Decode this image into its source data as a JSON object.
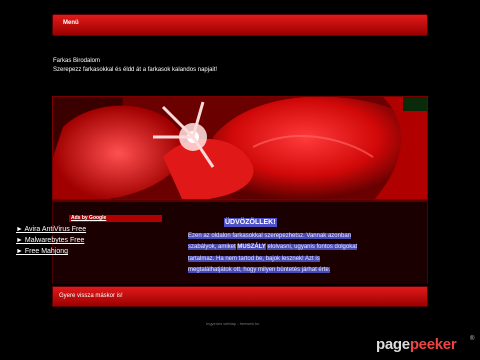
{
  "nav": {
    "menu_label": "Menü"
  },
  "site": {
    "title": "Farkas Birodalom",
    "subtitle": "Szerepezz farkasokkal és éldd át a farkasok kalandos napjait!"
  },
  "ads": {
    "header": "Ads by Google",
    "links": [
      "► Avira AntiVirus Free",
      "► Malwarebytes Free",
      "► Free Mahjong"
    ]
  },
  "welcome": {
    "title": "ÜDVÖZÖLLEK!",
    "lines": [
      "Ezen az oldalon farkasokkal szerepezhetsz. Vannak azonban",
      "szabályok, amiket",
      "MUSZÁLY",
      "elolvasni, ugyanis fontos dolgokat",
      "tartalmaz. Ha nem tartod be, bajok lesznek! Azt is",
      "megtalálhatjátok ott, hogy milyen büntetés járhat érte."
    ]
  },
  "footer": {
    "text": "Gyere vissza máskor is!"
  },
  "credit": {
    "text": "Ingyenes weblap - freeweb.hu"
  },
  "watermark": {
    "part1": "page",
    "part2": "peeker",
    "reg": "®"
  },
  "colors": {
    "bar_top": "#e01a1a",
    "bar_bottom": "#9b0000",
    "highlight": "#4a4ab4",
    "background": "#000000"
  }
}
